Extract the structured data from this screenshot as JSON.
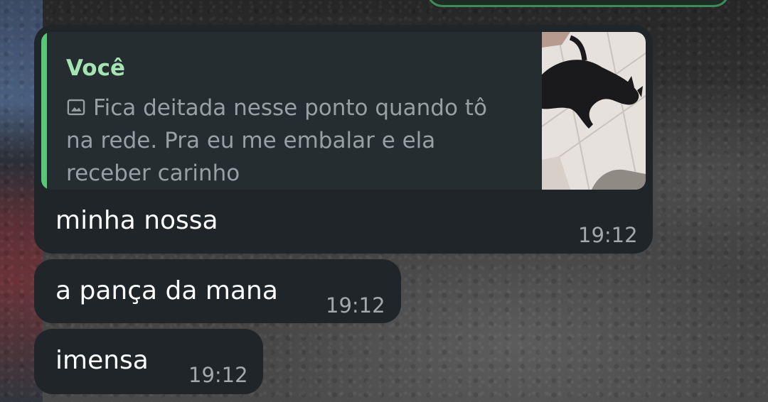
{
  "chat": {
    "messages": [
      {
        "reply_to": {
          "author": "Você",
          "media_icon": "image-icon",
          "text": "Fica deitada nesse ponto quando tô na rede. Pra eu me embalar e ela receber carinho",
          "thumbnail": "black-cat-lying-on-white-tile-floor"
        },
        "text": "minha nossa",
        "time": "19:12"
      },
      {
        "text": "a pança da mana",
        "time": "19:12"
      },
      {
        "text": "imensa",
        "time": "19:12"
      }
    ]
  },
  "colors": {
    "bubble": "#1f2529",
    "quote_background": "#252d31",
    "quote_accent": "#5ac67a",
    "quote_author": "#a6e3b3",
    "quote_text": "#98a0a4",
    "message_text": "#ffffff",
    "timestamp": "#a3a8ab"
  }
}
